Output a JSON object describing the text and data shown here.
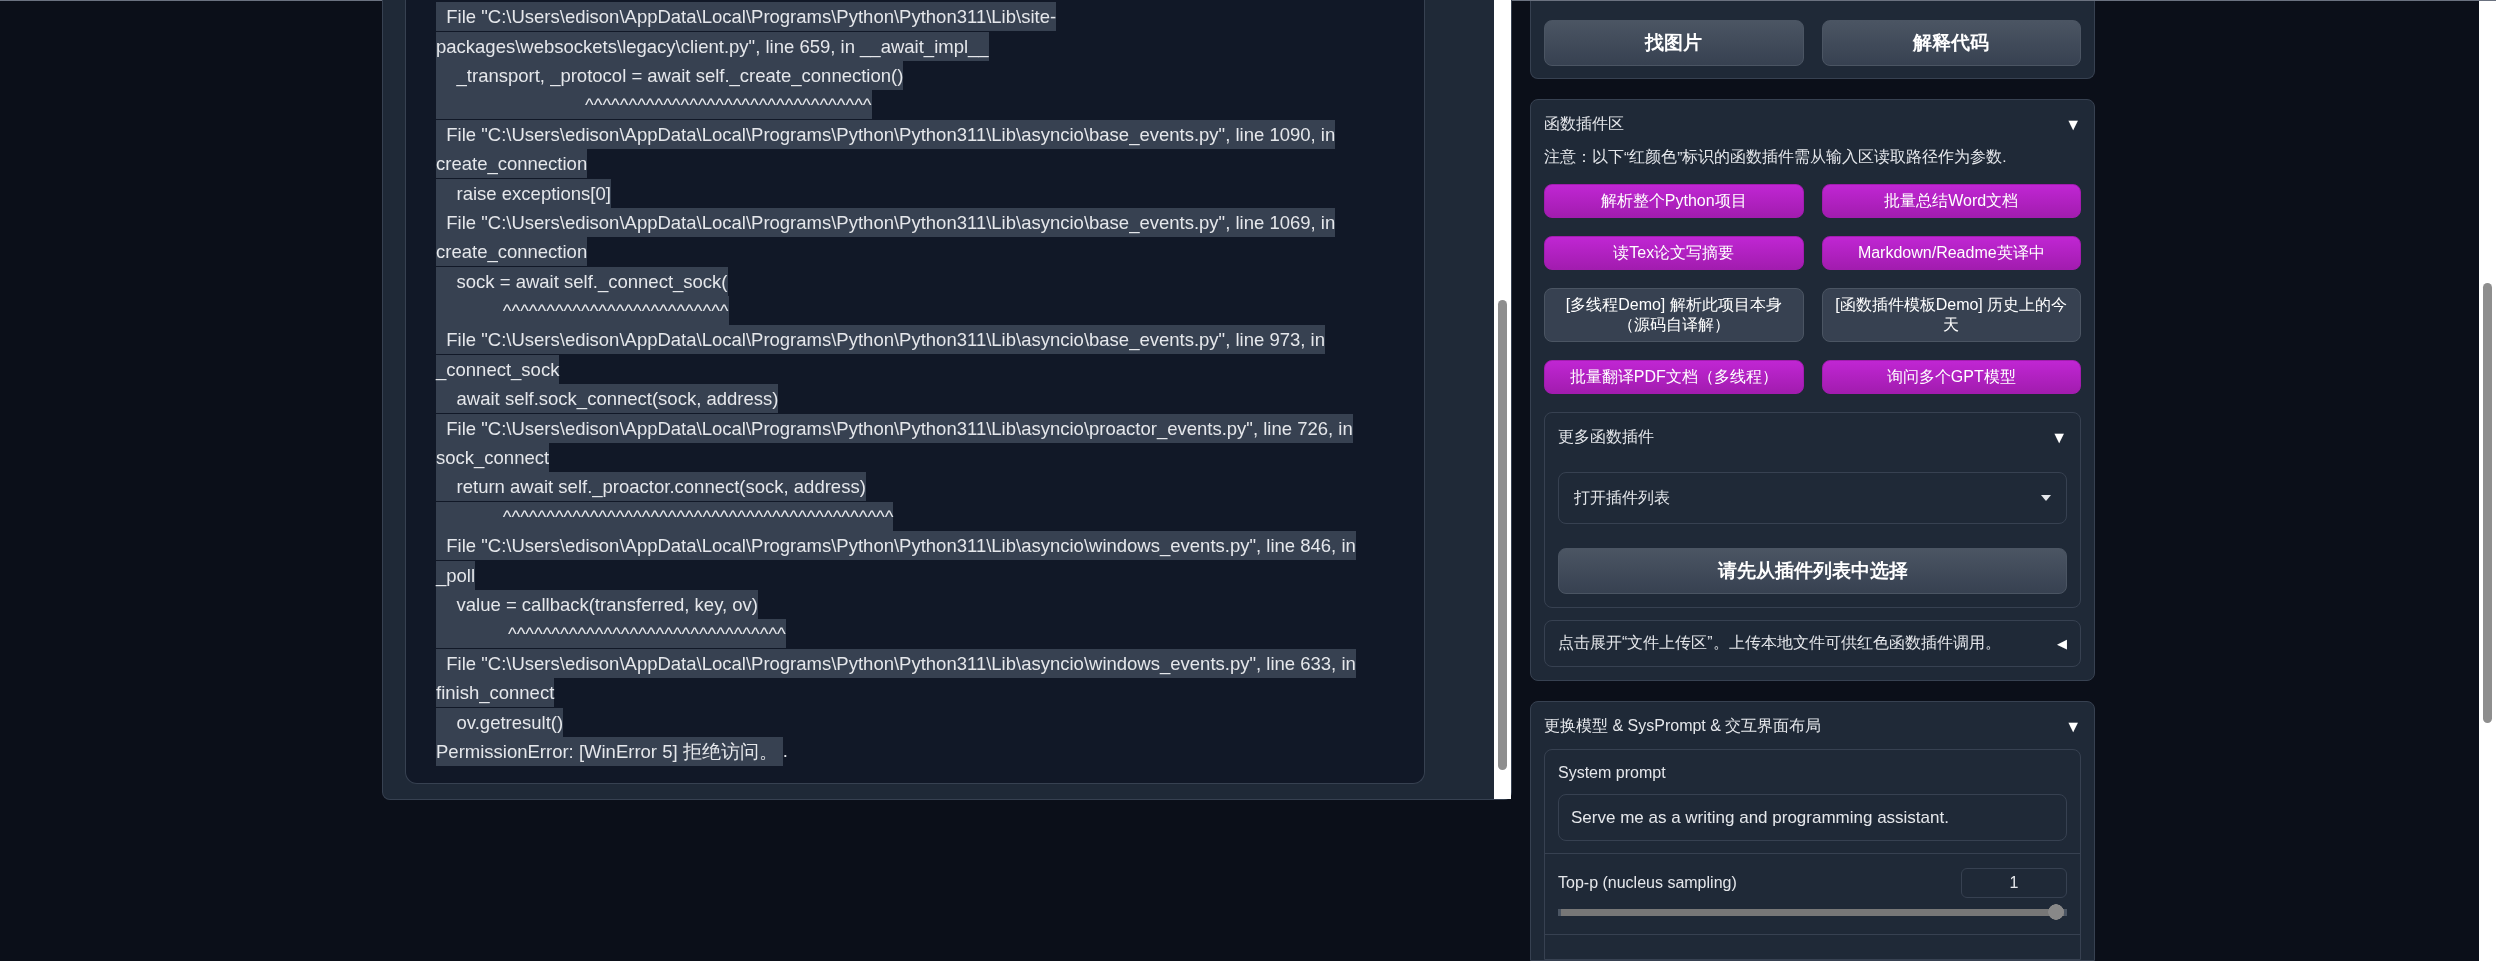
{
  "traceback": {
    "lines": [
      "  File \"C:\\Users\\edison\\AppData\\Local\\Programs\\Python\\Python311\\Lib\\site-",
      "packages\\websockets\\legacy\\client.py\", line 659, in __await_impl__",
      "    _transport, _protocol = await self._create_connection()",
      "                             ^^^^^^^^^^^^^^^^^^^^^^^^^^^^^^^^^",
      "  File \"C:\\Users\\edison\\AppData\\Local\\Programs\\Python\\Python311\\Lib\\asyncio\\base_events.py\", line 1090, in",
      "create_connection",
      "    raise exceptions[0]",
      "  File \"C:\\Users\\edison\\AppData\\Local\\Programs\\Python\\Python311\\Lib\\asyncio\\base_events.py\", line 1069, in",
      "create_connection",
      "    sock = await self._connect_sock(",
      "             ^^^^^^^^^^^^^^^^^^^^^^^^^^",
      "  File \"C:\\Users\\edison\\AppData\\Local\\Programs\\Python\\Python311\\Lib\\asyncio\\base_events.py\", line 973, in",
      "_connect_sock",
      "    await self.sock_connect(sock, address)",
      "  File \"C:\\Users\\edison\\AppData\\Local\\Programs\\Python\\Python311\\Lib\\asyncio\\proactor_events.py\", line 726, in",
      "sock_connect",
      "    return await self._proactor.connect(sock, address)",
      "             ^^^^^^^^^^^^^^^^^^^^^^^^^^^^^^^^^^^^^^^^^^^^^",
      "  File \"C:\\Users\\edison\\AppData\\Local\\Programs\\Python\\Python311\\Lib\\asyncio\\windows_events.py\", line 846, in",
      "_poll",
      "    value = callback(transferred, key, ov)",
      "              ^^^^^^^^^^^^^^^^^^^^^^^^^^^^^^^^",
      "  File \"C:\\Users\\edison\\AppData\\Local\\Programs\\Python\\Python311\\Lib\\asyncio\\windows_events.py\", line 633, in",
      "finish_connect",
      "    ov.getresult()",
      "PermissionError: [WinError 5] 拒绝访问。 "
    ],
    "tail": "."
  },
  "top_buttons": [
    "找图片",
    "解释代码"
  ],
  "plugin_section": {
    "title": "函数插件区",
    "arrow": "▼",
    "note": "注意：以下“红颜色”标识的函数插件需从输入区读取路径作为参数.",
    "plugins": [
      {
        "label": "解析整个Python项目",
        "kind": "highlight"
      },
      {
        "label": "批量总结Word文档",
        "kind": "highlight"
      },
      {
        "label": "读Tex论文写摘要",
        "kind": "highlight"
      },
      {
        "label": "Markdown/Readme英译中",
        "kind": "highlight"
      },
      {
        "label": "[多线程Demo] 解析此项目本身（源码自译解）",
        "kind": "default"
      },
      {
        "label": "[函数插件模板Demo] 历史上的今天",
        "kind": "default"
      },
      {
        "label": "批量翻译PDF文档（多线程）",
        "kind": "highlight"
      },
      {
        "label": "询问多个GPT模型",
        "kind": "highlight"
      }
    ],
    "more": {
      "title": "更多函数插件",
      "arrow": "▼",
      "dropdown": "打开插件列表",
      "run_button": "请先从插件列表中选择"
    },
    "upload": {
      "title": "点击展开“文件上传区”。上传本地文件可供红色函数插件调用。",
      "arrow": "◀"
    }
  },
  "model_section": {
    "title": "更换模型 & SysPrompt & 交互界面布局",
    "arrow": "▼",
    "system_prompt": {
      "label": "System prompt",
      "value": "Serve me as a writing and programming assistant."
    },
    "top_p": {
      "label": "Top-p (nucleus sampling)",
      "value": "1",
      "level": 1
    }
  }
}
